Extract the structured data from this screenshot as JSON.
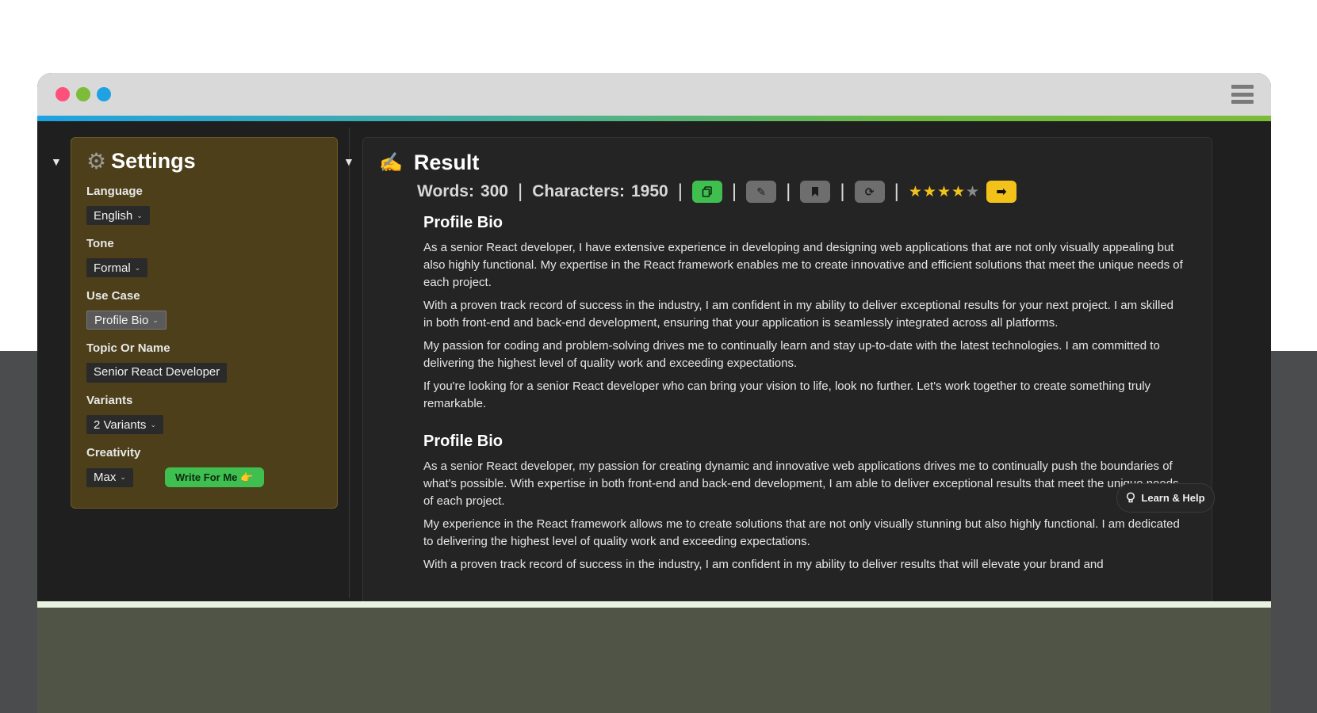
{
  "window": {
    "accent_colors": [
      "#1ea2e3",
      "#7cbc38"
    ]
  },
  "settings": {
    "title": "Settings",
    "icon": "gear-icon",
    "language": {
      "label": "Language",
      "value": "English"
    },
    "tone": {
      "label": "Tone",
      "value": "Formal"
    },
    "use_case": {
      "label": "Use Case",
      "value": "Profile Bio"
    },
    "topic": {
      "label": "Topic Or Name",
      "value": "Senior React Developer"
    },
    "variants": {
      "label": "Variants",
      "value": "2 Variants"
    },
    "creativity": {
      "label": "Creativity",
      "value": "Max"
    },
    "write_button": "Write For Me",
    "write_button_emoji": "👉"
  },
  "result": {
    "title": "Result",
    "icon": "writing-hand-icon",
    "emoji": "✍️",
    "words_label": "Words:",
    "words_value": "300",
    "chars_label": "Characters:",
    "chars_value": "1950",
    "rating": 4,
    "rating_max": 5,
    "bios": [
      {
        "title": "Profile Bio",
        "paragraphs": [
          "As a senior React developer, I have extensive experience in developing and designing web applications that are not only visually appealing but also highly functional. My expertise in the React framework enables me to create innovative and efficient solutions that meet the unique needs of each project.",
          "With a proven track record of success in the industry, I am confident in my ability to deliver exceptional results for your next project. I am skilled in both front-end and back-end development, ensuring that your application is seamlessly integrated across all platforms.",
          "My passion for coding and problem-solving drives me to continually learn and stay up-to-date with the latest technologies. I am committed to delivering the highest level of quality work and exceeding expectations.",
          "If you're looking for a senior React developer who can bring your vision to life, look no further. Let's work together to create something truly remarkable."
        ]
      },
      {
        "title": "Profile Bio",
        "paragraphs": [
          "As a senior React developer, my passion for creating dynamic and innovative web applications drives me to continually push the boundaries of what's possible. With expertise in both front-end and back-end development, I am able to deliver exceptional results that meet the unique needs of each project.",
          "My experience in the React framework allows me to create solutions that are not only visually stunning but also highly functional. I am dedicated to delivering the highest level of quality work and exceeding expectations.",
          "With a proven track record of success in the industry, I am confident in my ability to deliver results that will elevate your brand and"
        ]
      }
    ]
  },
  "help": {
    "label": "Learn & Help",
    "icon": "lightbulb-icon"
  }
}
